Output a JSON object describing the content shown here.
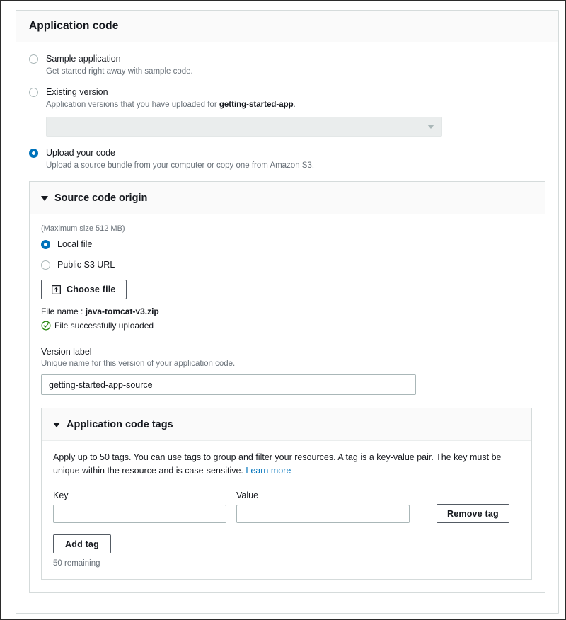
{
  "card": {
    "title": "Application code"
  },
  "code_source_options": [
    {
      "label": "Sample application",
      "description": "Get started right away with sample code.",
      "selected": false
    },
    {
      "label": "Existing version",
      "description_pre": "Application versions that you have uploaded for ",
      "description_bold": "getting-started-app",
      "description_post": ".",
      "selected": false
    },
    {
      "label": "Upload your code",
      "description": "Upload a source bundle from your computer or copy one from Amazon S3.",
      "selected": true
    }
  ],
  "existing_version_select": {
    "value": "",
    "placeholder": "",
    "disabled": true,
    "caret_icon": "chevron-down-icon"
  },
  "source_code_origin": {
    "title": "Source code origin",
    "expanded": true,
    "disclosure_icon": "triangle-down-icon",
    "max_size_note": "(Maximum size 512 MB)",
    "origin_options": [
      {
        "label": "Local file",
        "selected": true
      },
      {
        "label": "Public S3 URL",
        "selected": false
      }
    ],
    "choose_file_button": "Choose file",
    "choose_file_icon": "upload-icon",
    "file_name_label": "File name :",
    "file_name_value": "java-tomcat-v3.zip",
    "upload_status": "File successfully uploaded",
    "upload_status_icon": "check-circle-icon",
    "upload_status_color": "#1d8102",
    "version_label": {
      "label": "Version label",
      "description": "Unique name for this version of your application code.",
      "value": "getting-started-app-source",
      "placeholder": ""
    }
  },
  "application_code_tags": {
    "title": "Application code tags",
    "expanded": true,
    "disclosure_icon": "triangle-down-icon",
    "description_pre": "Apply up to 50 tags. You can use tags to group and filter your resources. A tag is a key-value pair. The key must be unique within the resource and is case-sensitive. ",
    "learn_more": "Learn more",
    "columns": {
      "key": "Key",
      "value": "Value"
    },
    "rows": [
      {
        "key": "",
        "value": "",
        "remove_label": "Remove tag"
      }
    ],
    "add_tag_button": "Add tag",
    "remaining": "50 remaining"
  },
  "colors": {
    "accent": "#0073bb",
    "link": "#0073bb",
    "success": "#1d8102",
    "text": "#16191f",
    "muted": "#687078",
    "border": "#aab7b8",
    "panel_border": "#d5dbdb",
    "header_bg": "#fafafa",
    "disabled_bg": "#eaeded"
  }
}
